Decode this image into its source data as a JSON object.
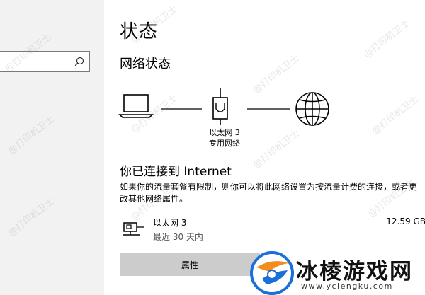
{
  "sidebar": {
    "search": {
      "placeholder": ""
    }
  },
  "page": {
    "title": "状态",
    "section_title": "网络状态",
    "adapter": {
      "name": "以太网 3",
      "network_type": "专用网络"
    },
    "connected_title": "你已连接到 Internet",
    "description": "如果你的流量套餐有限制，则你可以将此网络设置为按流量计费的连接，或者更改其他网络属性。",
    "connection": {
      "name": "以太网 3",
      "subtitle": "最近 30 天内",
      "usage": "12.59 GB"
    },
    "properties_button": "属性"
  },
  "watermark": "@打印机卫士",
  "logo": {
    "text": "冰棱游戏网",
    "url": "www.yclengku.com"
  },
  "colors": {
    "accent": "#0078d7",
    "sidebar_bg": "#f2f2f2",
    "button_bg": "#cccccc",
    "logo_blue": "#1a6fd9",
    "logo_orange": "#f28c1e"
  },
  "icons": [
    "search-icon",
    "laptop-icon",
    "ethernet-icon",
    "globe-icon",
    "ethernet-adapter-icon"
  ]
}
